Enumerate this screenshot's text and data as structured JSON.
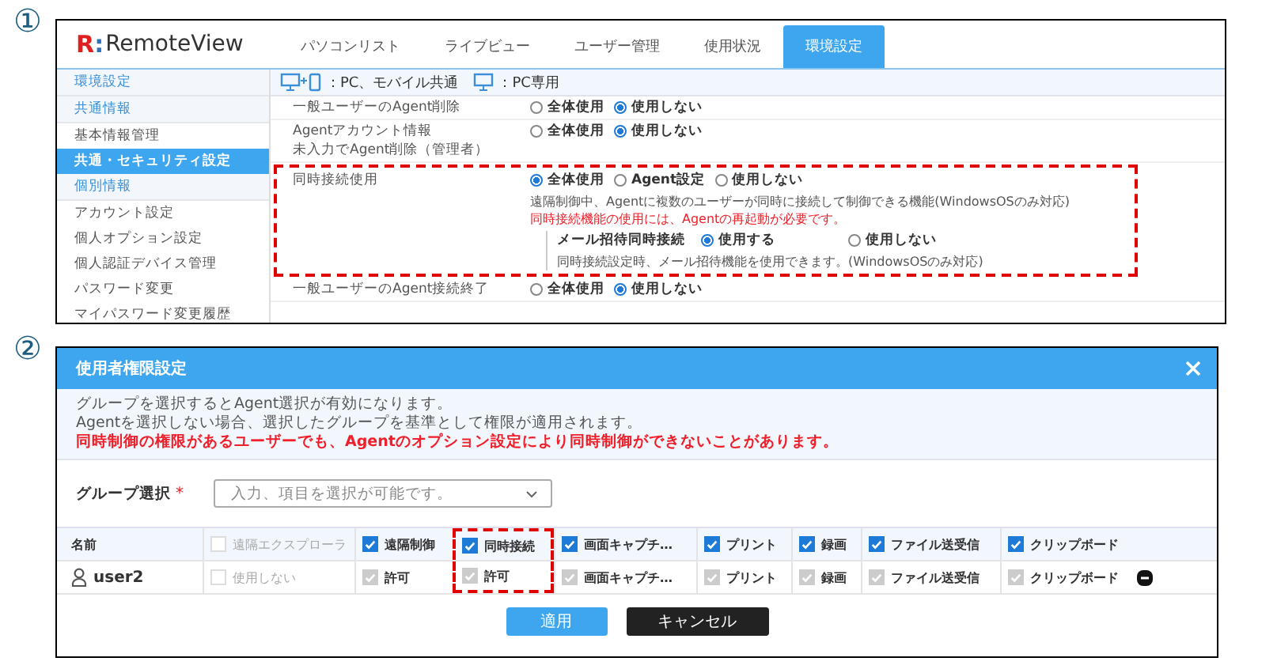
{
  "panel_1": {
    "marker": "①",
    "logo": {
      "mark": "R",
      "separator": ":",
      "name": "RemoteView"
    },
    "nav_tabs": [
      {
        "label": "パソコンリスト",
        "selected": false
      },
      {
        "label": "ライブビュー",
        "selected": false
      },
      {
        "label": "ユーザー管理",
        "selected": false
      },
      {
        "label": "使用状況",
        "selected": false
      },
      {
        "label": "環境設定",
        "selected": true
      }
    ],
    "legend": {
      "both": "：PC、モバイル共通",
      "pc": "：PC専用"
    },
    "sidebar": [
      {
        "label": "環境設定",
        "kind": "section"
      },
      {
        "label": "共通情報",
        "kind": "section"
      },
      {
        "label": "基本情報管理",
        "kind": "item",
        "selected": false
      },
      {
        "label": "共通・セキュリティ設定",
        "kind": "item",
        "selected": true
      },
      {
        "label": "個別情報",
        "kind": "section"
      },
      {
        "label": "アカウント設定",
        "kind": "item",
        "selected": false
      },
      {
        "label": "個人オプション設定",
        "kind": "item",
        "selected": false
      },
      {
        "label": "個人認証デバイス管理",
        "kind": "item",
        "selected": false
      },
      {
        "label": "パスワード変更",
        "kind": "item",
        "selected": false
      },
      {
        "label": "マイパスワード変更履歴",
        "kind": "item",
        "selected": false
      }
    ],
    "settings": [
      {
        "label": [
          "一般ユーザーのAgent削除"
        ],
        "highlighted": false,
        "options": [
          {
            "label": "全体使用",
            "selected": false
          },
          {
            "label": "使用しない",
            "selected": true
          }
        ]
      },
      {
        "label": [
          "Agentアカウント情報",
          "未入力でAgent削除（管理者）"
        ],
        "highlighted": false,
        "options": [
          {
            "label": "全体使用",
            "selected": false
          },
          {
            "label": "使用しない",
            "selected": true
          }
        ]
      },
      {
        "label": [
          "同時接続使用"
        ],
        "highlighted": true,
        "options": [
          {
            "label": "全体使用",
            "selected": true
          },
          {
            "label": "Agent設定",
            "selected": false
          },
          {
            "label": "使用しない",
            "selected": false
          }
        ],
        "description": "遠隔制御中、Agentに複数のユーザーが同時に接続して制御できる機能(WindowsOSのみ対応)",
        "warning": "同時接続機能の使用には、Agentの再起動が必要です。",
        "sub": {
          "label": "メール招待同時接続",
          "options": [
            {
              "label": "使用する",
              "selected": true
            },
            {
              "label": "使用しない",
              "selected": false
            }
          ],
          "description": "同時接続設定時、メール招待機能を使用できます。(WindowsOSのみ対応)"
        }
      },
      {
        "label": [
          "一般ユーザーのAgent接続終了"
        ],
        "highlighted": false,
        "options": [
          {
            "label": "全体使用",
            "selected": false
          },
          {
            "label": "使用しない",
            "selected": true
          }
        ]
      }
    ]
  },
  "panel_2": {
    "marker": "②",
    "title": "使用者権限設定",
    "info": [
      "グループを選択するとAgent選択が有効になります。",
      "Agentを選択しない場合、選択したグループを基準として権限が適用されます。"
    ],
    "warning": "同時制御の権限があるユーザーでも、Agentのオプション設定により同時制御ができないことがあります。",
    "group_select": {
      "label": "グループ選択",
      "required_mark": "*",
      "placeholder": "入力、項目を選択が可能です。"
    },
    "table": {
      "name_header": "名前",
      "columns": [
        {
          "label": "遠隔エクスプローラ",
          "checked": false,
          "disabled": true,
          "highlighted": false
        },
        {
          "label": "遠隔制御",
          "checked": true,
          "disabled": false,
          "highlighted": false
        },
        {
          "label": "同時接続",
          "checked": true,
          "disabled": false,
          "highlighted": true
        },
        {
          "label": "画面キャプチ…",
          "checked": true,
          "disabled": false,
          "highlighted": false
        },
        {
          "label": "プリント",
          "checked": true,
          "disabled": false,
          "highlighted": false
        },
        {
          "label": "録画",
          "checked": true,
          "disabled": false,
          "highlighted": false
        },
        {
          "label": "ファイル送受信",
          "checked": true,
          "disabled": false,
          "highlighted": false
        },
        {
          "label": "クリップボード",
          "checked": true,
          "disabled": false,
          "highlighted": false
        }
      ],
      "rows": [
        {
          "name": "user2",
          "cells": [
            {
              "label": "使用しない",
              "checked": false,
              "disabled": true
            },
            {
              "label": "許可",
              "checked": true,
              "disabled": true
            },
            {
              "label": "許可",
              "checked": true,
              "disabled": true
            },
            {
              "label": "画面キャプチ…",
              "checked": true,
              "disabled": true
            },
            {
              "label": "プリント",
              "checked": true,
              "disabled": true
            },
            {
              "label": "録画",
              "checked": true,
              "disabled": true
            },
            {
              "label": "ファイル送受信",
              "checked": true,
              "disabled": true
            },
            {
              "label": "クリップボード",
              "checked": true,
              "disabled": true
            }
          ]
        }
      ]
    },
    "buttons": [
      {
        "label": "適用",
        "kind": "primary"
      },
      {
        "label": "キャンセル",
        "kind": "dark"
      }
    ]
  }
}
